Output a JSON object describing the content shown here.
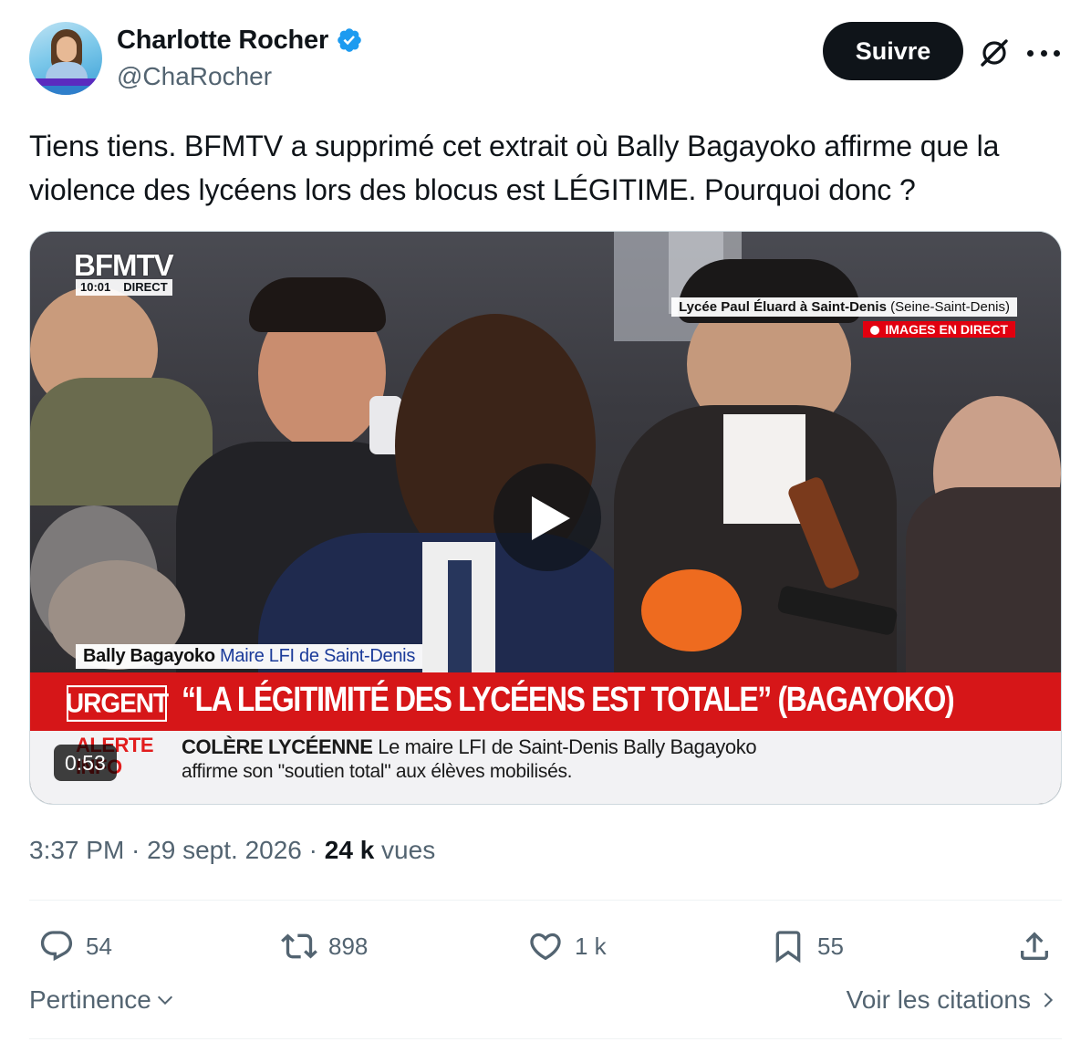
{
  "author": {
    "display_name": "Charlotte Rocher",
    "handle": "@ChaRocher",
    "verified_icon": "verified-badge-icon",
    "avatar_icon": "profile-photo"
  },
  "header": {
    "follow_label": "Suivre",
    "grok_icon": "grok-icon",
    "more_icon": "more-options-icon"
  },
  "tweet": {
    "text": "Tiens tiens. BFMTV a supprimé cet extrait où Bally Bagayoko affirme que la violence des lycéens lors des blocus est LÉGITIME. Pourquoi donc ?"
  },
  "video": {
    "channel_logo": "BFMTV",
    "time": "10:01",
    "direct": "DIRECT",
    "location_main": "Lycée Paul Éluard à Saint-Denis",
    "location_sub": "(Seine-Saint-Denis)",
    "live_label": "IMAGES EN DIRECT",
    "name_tag_person": "Bally Bagayoko",
    "name_tag_role": "Maire LFI de Saint-Denis",
    "urgent_label": "URGENT",
    "headline": "“LA LÉGITIMITÉ DES LYCÉENS EST TOTALE” (BAGAYOKO)",
    "alerte_line1": "ALERTE",
    "alerte_line2": "INFO",
    "topic": "COLÈRE LYCÉENNE",
    "topic_text": "Le maire LFI de Saint-Denis Bally Bagayoko",
    "topic_text2": "affirme son \"soutien total\" aux élèves mobilisés.",
    "duration": "0:53",
    "play_icon": "play-icon"
  },
  "meta": {
    "time": "3:37 PM",
    "sep1": " · ",
    "date": "29 sept. 2026",
    "sep2": " · ",
    "views_count": "24 k",
    "views_label": "vues"
  },
  "actions": {
    "replies": "54",
    "retweets": "898",
    "likes": "1 k",
    "bookmarks": "55"
  },
  "replies_section": {
    "sort_label": "Pertinence",
    "quotes_label": "Voir les citations"
  },
  "colors": {
    "text": "#0f1419",
    "secondary": "#536471",
    "verified": "#1d9bf0",
    "bfm_red": "#d61618"
  }
}
